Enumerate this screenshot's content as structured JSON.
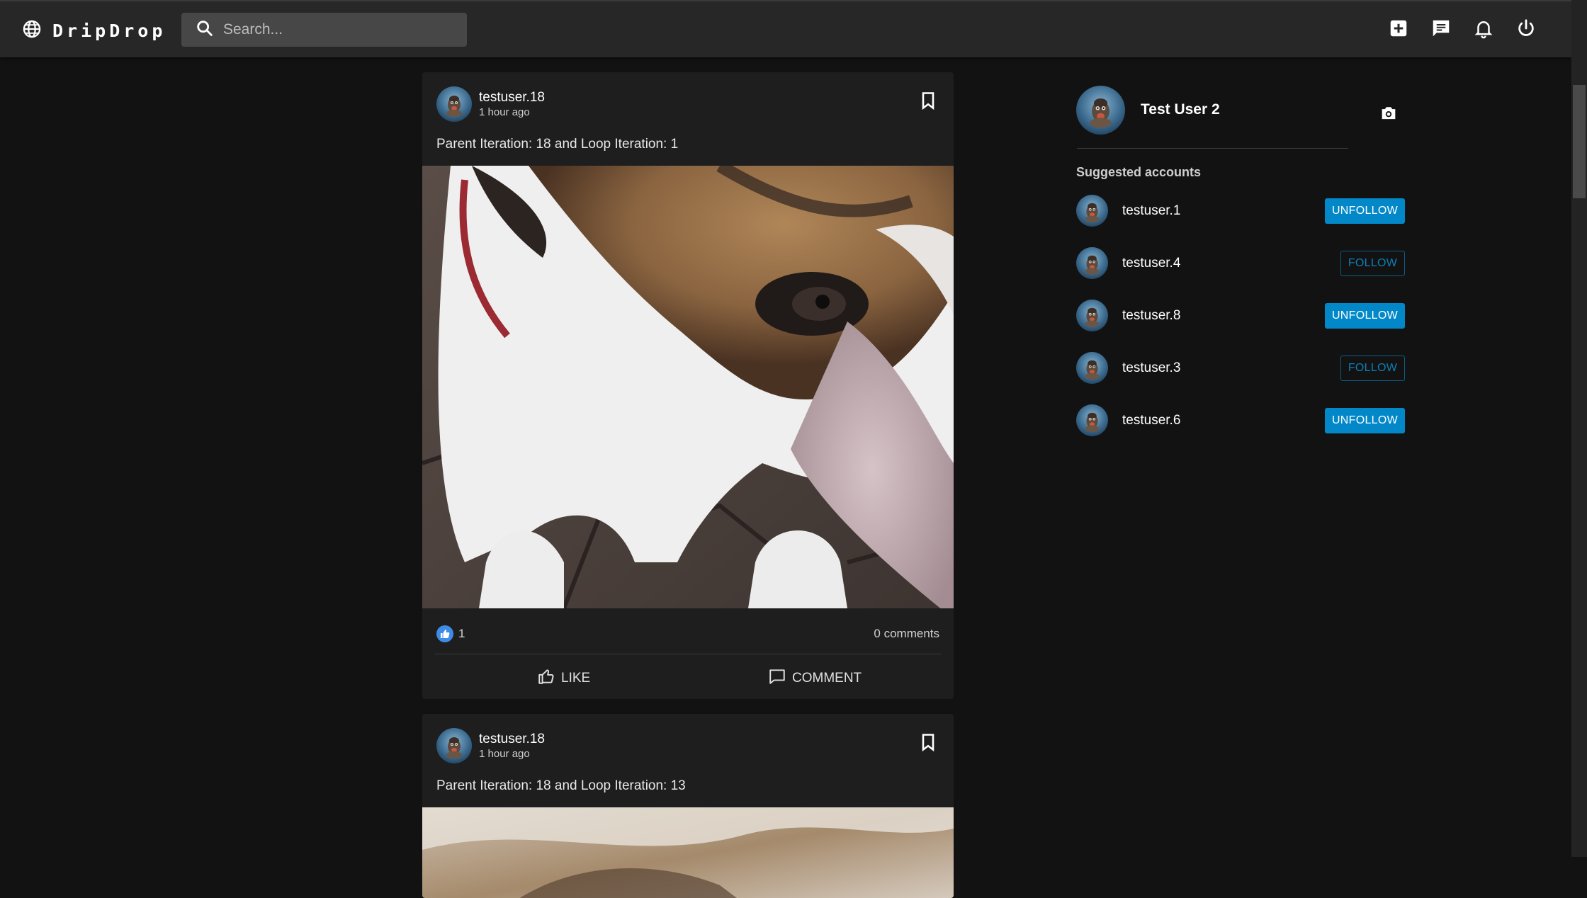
{
  "brand": {
    "name": "DripDrop",
    "icon": "globe-icon"
  },
  "search": {
    "placeholder": "Search...",
    "value": ""
  },
  "header_icons": [
    "add-box-icon",
    "chat-icon",
    "bell-icon",
    "power-icon"
  ],
  "posts": [
    {
      "username": "testuser.18",
      "time": "1 hour ago",
      "text": "Parent Iteration: 18 and Loop Iteration: 1",
      "likes": "1",
      "comments": "0 comments",
      "like_label": "LIKE",
      "comment_label": "COMMENT"
    },
    {
      "username": "testuser.18",
      "time": "1 hour ago",
      "text": "Parent Iteration: 18 and Loop Iteration: 13"
    }
  ],
  "profile": {
    "name": "Test User 2"
  },
  "suggested": {
    "title": "Suggested accounts",
    "accounts": [
      {
        "name": "testuser.1",
        "action": "UNFOLLOW"
      },
      {
        "name": "testuser.4",
        "action": "FOLLOW"
      },
      {
        "name": "testuser.8",
        "action": "UNFOLLOW"
      },
      {
        "name": "testuser.3",
        "action": "FOLLOW"
      },
      {
        "name": "testuser.6",
        "action": "UNFOLLOW"
      }
    ]
  },
  "colors": {
    "accent": "#0288c9",
    "background": "#121212",
    "surface": "#1e1e1e",
    "appbar": "#272727"
  }
}
